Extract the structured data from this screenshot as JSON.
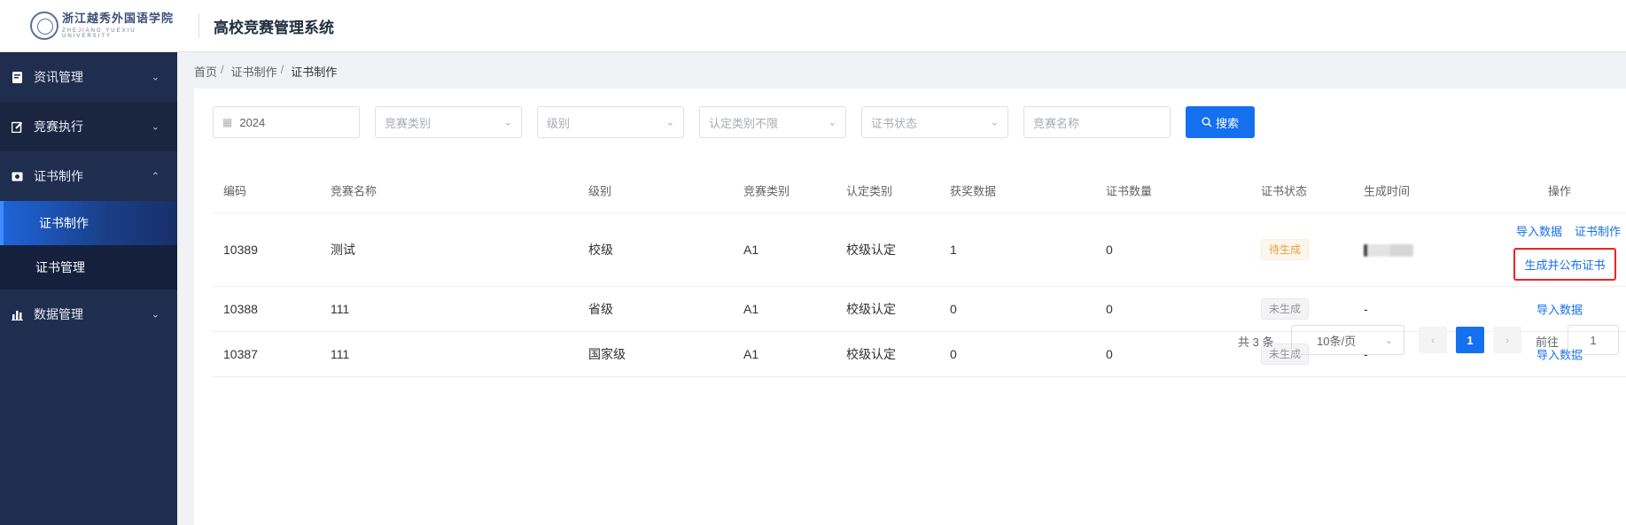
{
  "header": {
    "logo_cn": "浙江越秀外国语学院",
    "logo_en": "ZHEJIANG YUEXIU UNIVERSITY",
    "app_title": "高校竞赛管理系统"
  },
  "sidebar": {
    "items": [
      {
        "label": "资讯管理",
        "icon": "document-icon"
      },
      {
        "label": "竞赛执行",
        "icon": "edit-icon"
      },
      {
        "label": "证书制作",
        "icon": "certificate-icon"
      },
      {
        "label": "数据管理",
        "icon": "bar-chart-icon"
      }
    ],
    "sub_items": [
      {
        "label": "证书制作",
        "active": true
      },
      {
        "label": "证书管理",
        "active": false
      }
    ]
  },
  "breadcrumb": {
    "home": "首页",
    "level1": "证书制作",
    "current": "证书制作"
  },
  "filters": {
    "year": "2024",
    "category_placeholder": "竞赛类别",
    "level_placeholder": "级别",
    "recognition_placeholder": "认定类别不限",
    "status_placeholder": "证书状态",
    "name_placeholder": "竞赛名称",
    "search_label": "搜索"
  },
  "table": {
    "headers": {
      "code": "编码",
      "name": "竞赛名称",
      "level": "级别",
      "category": "竞赛类别",
      "recognition": "认定类别",
      "awards": "获奖数据",
      "cert_count": "证书数量",
      "status": "证书状态",
      "time": "生成时间",
      "ops": "操作"
    },
    "rows": [
      {
        "code": "10389",
        "name": "测试",
        "level": "校级",
        "category": "A1",
        "recognition": "校级认定",
        "awards": "1",
        "cert_count": "0",
        "status": "待生成",
        "time": "",
        "ops": [
          "导入数据",
          "证书制作",
          "生成并公布证书"
        ]
      },
      {
        "code": "10388",
        "name": "111",
        "level": "省级",
        "category": "A1",
        "recognition": "校级认定",
        "awards": "0",
        "cert_count": "0",
        "status": "未生成",
        "time": "-",
        "ops": [
          "导入数据"
        ]
      },
      {
        "code": "10387",
        "name": "111",
        "level": "国家级",
        "category": "A1",
        "recognition": "校级认定",
        "awards": "0",
        "cert_count": "0",
        "status": "未生成",
        "time": "-",
        "ops": [
          "导入数据"
        ]
      }
    ]
  },
  "pagination": {
    "total": "共 3 条",
    "page_size": "10条/页",
    "current_page": "1",
    "goto_label": "前往",
    "goto_value": "1"
  },
  "colors": {
    "primary": "#1570ef",
    "sidebar": "#1f2d4e",
    "highlight_border": "#ee2222"
  }
}
